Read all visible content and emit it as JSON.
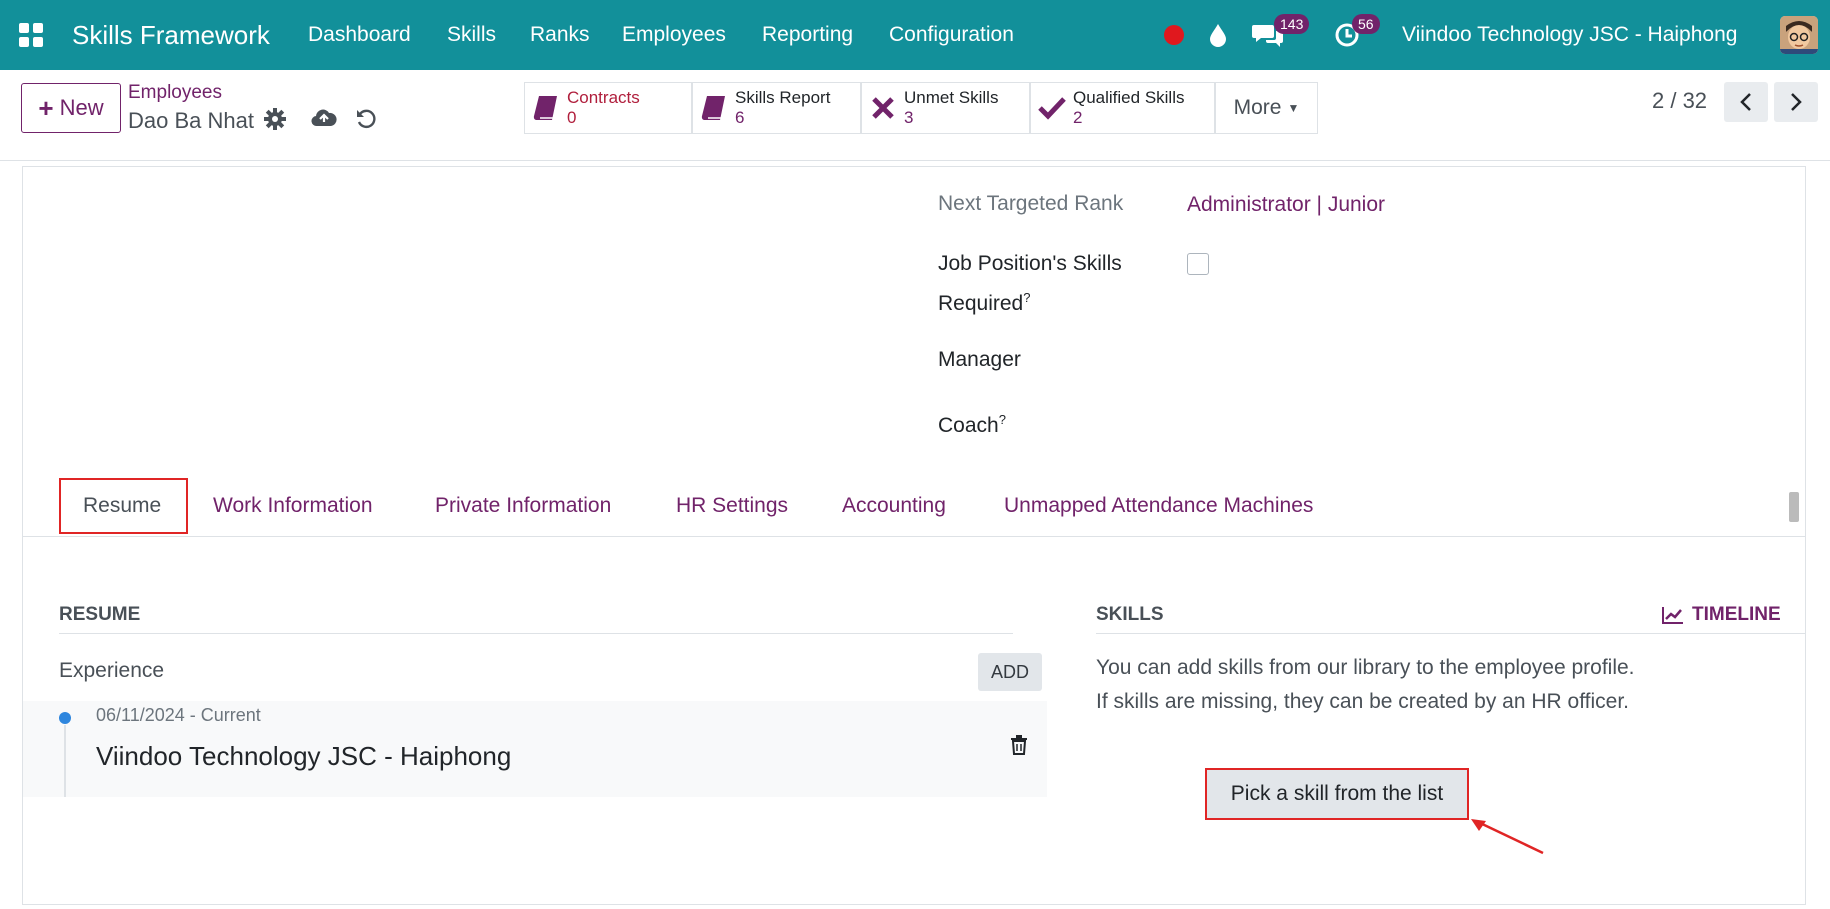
{
  "navbar": {
    "brand": "Skills Framework",
    "menu": [
      "Dashboard",
      "Skills",
      "Ranks",
      "Employees",
      "Reporting",
      "Configuration"
    ],
    "messages_count": "143",
    "activities_count": "56",
    "company": "Viindoo Technology JSC - Haiphong",
    "bg_color": "#12909a"
  },
  "control_panel": {
    "new_label": "New",
    "breadcrumb_parent": "Employees",
    "breadcrumb_current": "Dao Ba Nhat",
    "smart_buttons": [
      {
        "label": "Contracts",
        "value": "0",
        "icon": "book-icon"
      },
      {
        "label": "Skills Report",
        "value": "6",
        "icon": "book-icon"
      },
      {
        "label": "Unmet Skills",
        "value": "3",
        "icon": "x-icon"
      },
      {
        "label": "Qualified Skills",
        "value": "2",
        "icon": "check-icon"
      }
    ],
    "more_label": "More",
    "pager": "2 / 32"
  },
  "form": {
    "next_targeted_rank_label": "Next Targeted Rank",
    "next_targeted_rank_value": "Administrator | Junior",
    "job_skills_label_1": "Job Position's Skills",
    "job_skills_label_2": "Required",
    "job_skills_checked": false,
    "manager_label": "Manager",
    "coach_label": "Coach",
    "help_mark": "?"
  },
  "tabs": [
    "Resume",
    "Work Information",
    "Private Information",
    "HR Settings",
    "Accounting",
    "Unmapped Attendance Machines"
  ],
  "resume": {
    "title": "RESUME",
    "experience_label": "Experience",
    "add_label": "ADD",
    "entries": [
      {
        "date": "06/11/2024 - Current",
        "title": "Viindoo Technology JSC - Haiphong"
      }
    ]
  },
  "skills": {
    "title": "SKILLS",
    "timeline_label": "TIMELINE",
    "line1": "You can add skills from our library to the employee profile.",
    "line2": "If skills are missing, they can be created by an HR officer.",
    "pick_label": "Pick a skill from the list"
  },
  "colors": {
    "brand_purple": "#71236a",
    "highlight_red": "#e02525",
    "teal": "#12909a"
  }
}
